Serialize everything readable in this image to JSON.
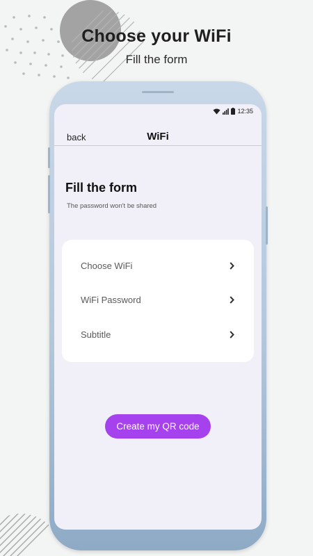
{
  "header": {
    "title": "Choose your WiFi",
    "subtitle": "Fill the form"
  },
  "status_bar": {
    "time": "12:35",
    "icons": [
      "wifi-icon",
      "signal-icon",
      "battery-icon"
    ]
  },
  "navbar": {
    "back_label": "back",
    "title": "WiFi"
  },
  "form": {
    "title": "Fill the form",
    "subtitle": "The password won't be shared",
    "rows": [
      {
        "label": "Choose WiFi",
        "icon": "chevron-right-icon"
      },
      {
        "label": "WiFi Password",
        "icon": "chevron-right-icon"
      },
      {
        "label": "Subtitle",
        "icon": "chevron-right-icon"
      }
    ]
  },
  "actions": {
    "create_qr_label": "Create my QR code"
  },
  "colors": {
    "accent": "#a641ee",
    "screen_bg": "#f1f0f8",
    "phone_frame": "#b3c7db",
    "page_bg": "#f3f4f4"
  }
}
